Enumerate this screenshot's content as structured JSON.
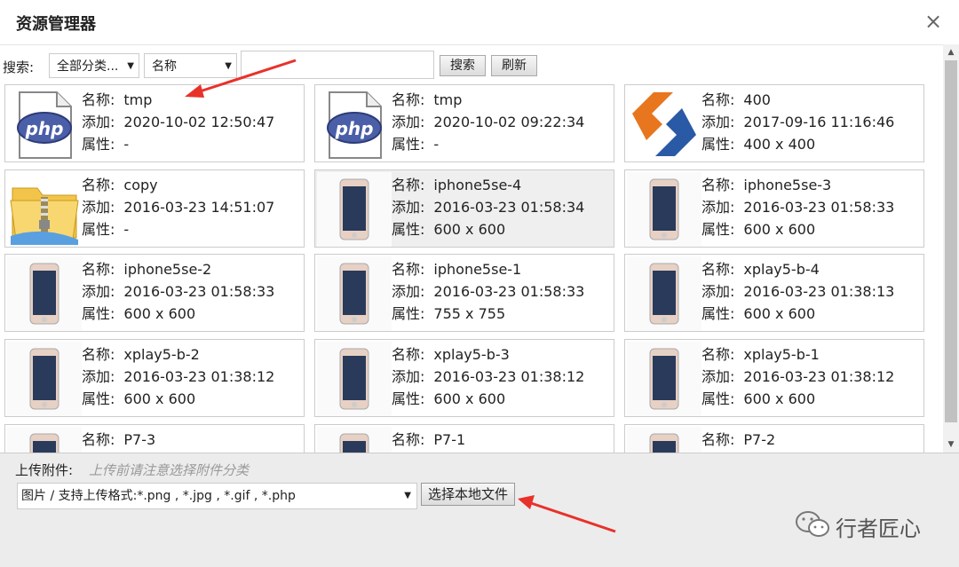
{
  "dialog": {
    "title": "资源管理器",
    "close_glyph": "×"
  },
  "toolbar": {
    "search_label": "搜索:",
    "category_select": "全部分类...",
    "field_select": "名称",
    "search_value": "",
    "search_button": "搜索",
    "refresh_button": "刷新"
  },
  "labels": {
    "name": "名称:",
    "added": "添加:",
    "attr": "属性:"
  },
  "files": [
    {
      "name": "tmp",
      "added": "2020-10-02 12:50:47",
      "attr": "-",
      "thumb": "php-file-icon"
    },
    {
      "name": "tmp",
      "added": "2020-10-02 09:22:34",
      "attr": "-",
      "thumb": "php-file-icon"
    },
    {
      "name": "400",
      "added": "2017-09-16 11:16:46",
      "attr": "400 x 400",
      "thumb": "logo-image"
    },
    {
      "name": "copy",
      "added": "2016-03-23 14:51:07",
      "attr": "-",
      "thumb": "zip-folder-icon"
    },
    {
      "name": "iphone5se-4",
      "added": "2016-03-23 01:58:34",
      "attr": "600 x 600",
      "thumb": "phone-image"
    },
    {
      "name": "iphone5se-3",
      "added": "2016-03-23 01:58:33",
      "attr": "600 x 600",
      "thumb": "phone-image"
    },
    {
      "name": "iphone5se-2",
      "added": "2016-03-23 01:58:33",
      "attr": "600 x 600",
      "thumb": "phone-image"
    },
    {
      "name": "iphone5se-1",
      "added": "2016-03-23 01:58:33",
      "attr": "755 x 755",
      "thumb": "phone-image"
    },
    {
      "name": "xplay5-b-4",
      "added": "2016-03-23 01:38:13",
      "attr": "600 x 600",
      "thumb": "phone-image"
    },
    {
      "name": "xplay5-b-2",
      "added": "2016-03-23 01:38:12",
      "attr": "600 x 600",
      "thumb": "phone-image"
    },
    {
      "name": "xplay5-b-3",
      "added": "2016-03-23 01:38:12",
      "attr": "600 x 600",
      "thumb": "phone-image"
    },
    {
      "name": "xplay5-b-1",
      "added": "2016-03-23 01:38:12",
      "attr": "600 x 600",
      "thumb": "phone-image"
    },
    {
      "name": "P7-3",
      "added": "",
      "attr": "",
      "thumb": "phone-image"
    },
    {
      "name": "P7-1",
      "added": "",
      "attr": "",
      "thumb": "phone-image"
    },
    {
      "name": "P7-2",
      "added": "",
      "attr": "",
      "thumb": "phone-image"
    }
  ],
  "upload": {
    "label": "上传附件:",
    "hint": "上传前请注意选择附件分类",
    "type_select": "图片 / 支持上传格式:*.png , *.jpg , *.gif , *.php",
    "choose_button": "选择本地文件"
  },
  "watermark": {
    "text": "行者匠心"
  },
  "colors": {
    "arrow": "#e8312a",
    "php_blue": "#4b5fa8",
    "logo_orange": "#e8761e",
    "logo_blue": "#2a5aa6"
  }
}
